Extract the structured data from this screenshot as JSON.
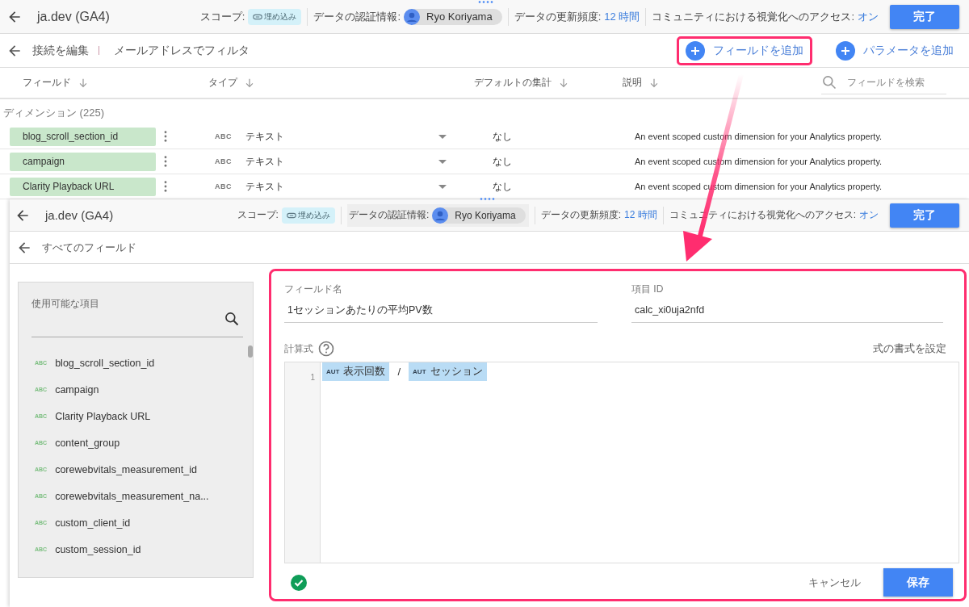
{
  "top_screen": {
    "header": {
      "title": "ja.dev (GA4)",
      "scope_label": "スコープ:",
      "scope_badge": "埋め込み",
      "credentials_label": "データの認証情報:",
      "credentials_user": "Ryo Koriyama",
      "refresh_label": "データの更新頻度:",
      "refresh_value": "12 時間",
      "community_label": "コミュニティにおける視覚化へのアクセス:",
      "community_value": "オン",
      "done_button": "完了"
    },
    "toolbar": {
      "back_label": "接続を編集",
      "filter_label": "メールアドレスでフィルタ",
      "add_field_button": {
        "label": "フィールドを追加",
        "highlighted": true
      },
      "add_parameter_button": {
        "label": "パラメータを追加",
        "highlighted": false
      }
    },
    "columns": [
      "フィールド",
      "タイプ",
      "デフォルトの集計",
      "説明"
    ],
    "search_placeholder": "フィールドを検索",
    "section_label": "ディメンション (225)",
    "rows": [
      {
        "name": "blog_scroll_section_id",
        "type_code": "ABC",
        "type": "テキスト",
        "aggregation": "なし",
        "description": "An event scoped custom dimension for your Analytics property."
      },
      {
        "name": "campaign",
        "type_code": "ABC",
        "type": "テキスト",
        "aggregation": "なし",
        "description": "An event scoped custom dimension for your Analytics property."
      },
      {
        "name": "Clarity Playback URL",
        "type_code": "ABC",
        "type": "テキスト",
        "aggregation": "なし",
        "description": "An event scoped custom dimension for your Analytics property."
      }
    ]
  },
  "editor_screen": {
    "header": {
      "title": "ja.dev (GA4)",
      "scope_label": "スコープ:",
      "scope_badge": "埋め込み",
      "credentials_label": "データの認証情報:",
      "credentials_user": "Ryo Koriyama",
      "refresh_label": "データの更新頻度:",
      "refresh_value": "12 時間",
      "community_label": "コミュニティにおける視覚化へのアクセス:",
      "community_value": "オン",
      "done_button": "完了"
    },
    "back_label": "すべてのフィールド",
    "available": {
      "title": "使用可能な項目",
      "items": [
        {
          "type_code": "ABC",
          "name": "blog_scroll_section_id"
        },
        {
          "type_code": "ABC",
          "name": "campaign"
        },
        {
          "type_code": "ABC",
          "name": "Clarity Playback URL"
        },
        {
          "type_code": "ABC",
          "name": "content_group"
        },
        {
          "type_code": "ABC",
          "name": "corewebvitals_measurement_id"
        },
        {
          "type_code": "ABC",
          "name": "corewebvitals_measurement_na..."
        },
        {
          "type_code": "ABC",
          "name": "custom_client_id"
        },
        {
          "type_code": "ABC",
          "name": "custom_session_id"
        }
      ]
    },
    "form": {
      "highlighted": true,
      "field_name_label": "フィールド名",
      "field_name_value": "1セッションあたりの平均PV数",
      "field_id_label": "項目 ID",
      "field_id_value": "calc_xi0uja2nfd",
      "formula_label": "計算式",
      "format_button": "式の書式を設定",
      "line_number": "1",
      "tokens": [
        {
          "kind": "field",
          "badge": "AUT",
          "label": "表示回数"
        },
        {
          "kind": "operator",
          "label": "/"
        },
        {
          "kind": "field",
          "badge": "AUT",
          "label": "セッション"
        }
      ],
      "cancel_button": "キャンセル",
      "save_button": "保存"
    }
  }
}
